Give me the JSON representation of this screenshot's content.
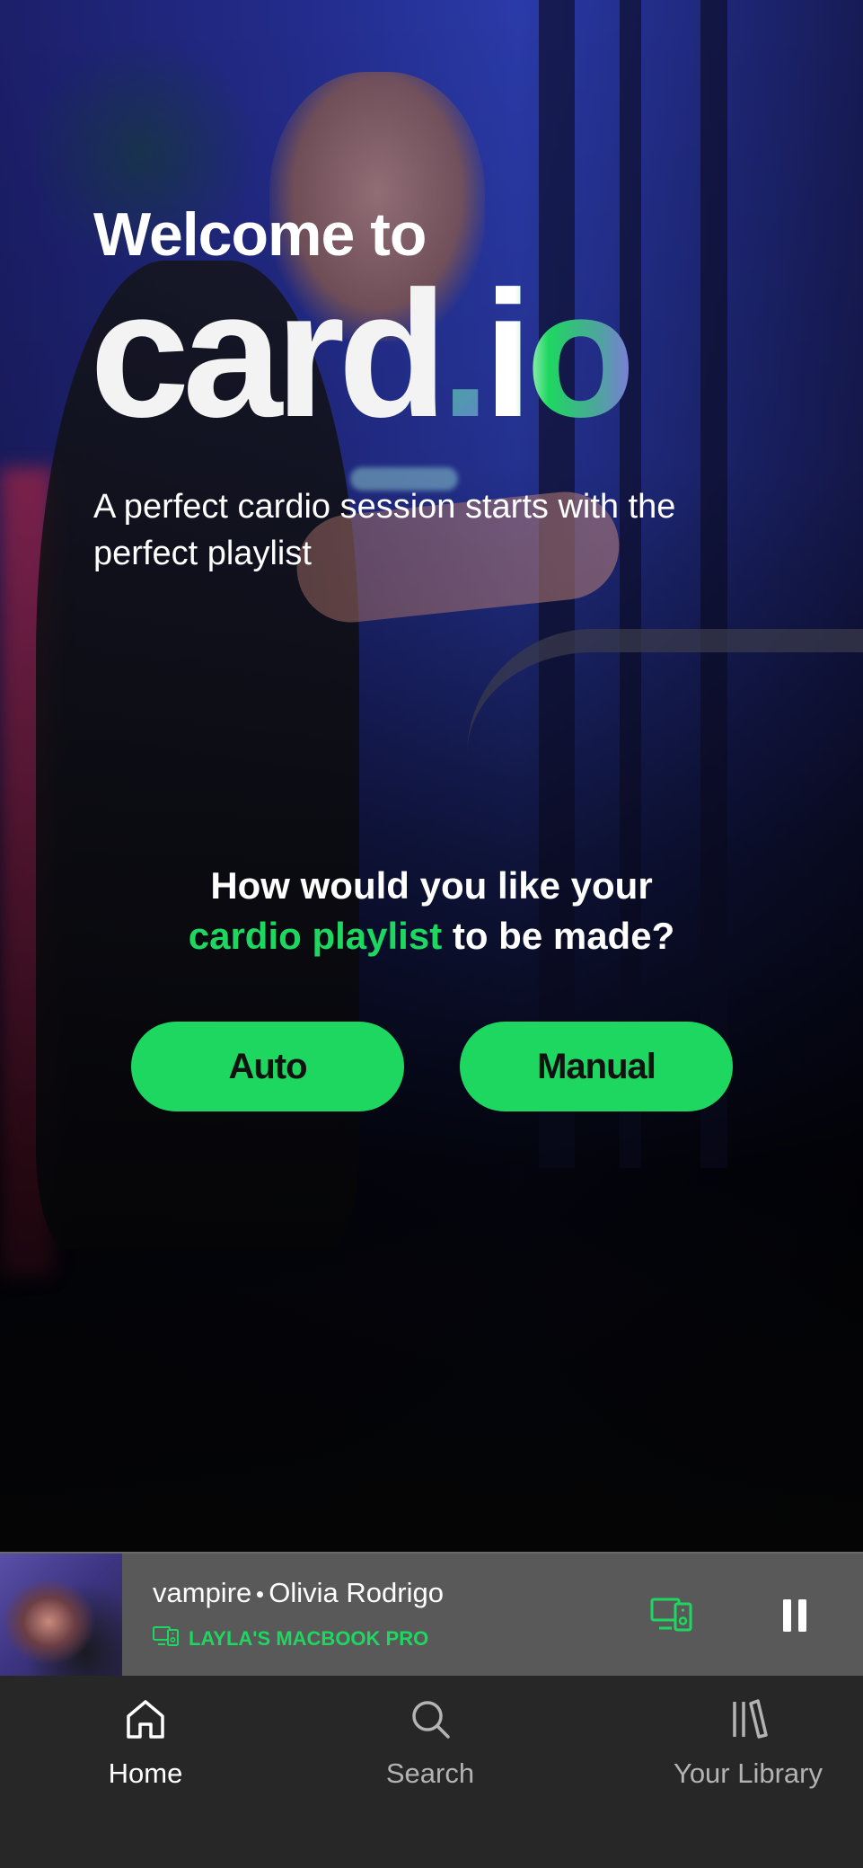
{
  "hero": {
    "welcome": "Welcome to",
    "brand_main": "card",
    "brand_dot": ".",
    "brand_suffix": "io",
    "subtitle": "A perfect cardio session starts with the perfect playlist"
  },
  "prompt": {
    "line1": "How would you like your",
    "accent": "cardio playlist",
    "line2_rest": " to be made?"
  },
  "buttons": {
    "auto": "Auto",
    "manual": "Manual"
  },
  "now_playing": {
    "song": "vampire",
    "artist": "Olivia Rodrigo",
    "device": "LAYLA'S MACBOOK PRO",
    "state": "playing"
  },
  "nav": {
    "home": "Home",
    "search": "Search",
    "library": "Your Library",
    "active": "home"
  },
  "colors": {
    "accent": "#1ed760",
    "player_bg": "#595959",
    "nav_bg": "#272727"
  }
}
